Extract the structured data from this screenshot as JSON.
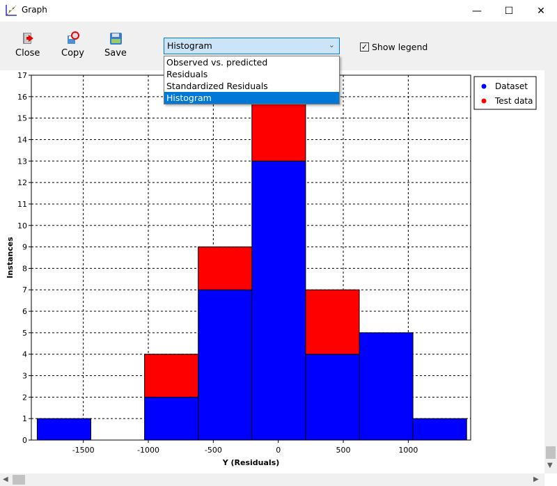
{
  "window": {
    "title": "Graph"
  },
  "toolbar": {
    "close": "Close",
    "copy": "Copy",
    "save": "Save",
    "show_legend": "Show legend",
    "show_legend_checked": true
  },
  "combo": {
    "selected": "Histogram",
    "options": [
      "Observed vs. predicted",
      "Residuals",
      "Standardized Residuals",
      "Histogram"
    ]
  },
  "chart_data": {
    "type": "bar",
    "stacked": true,
    "xlabel": "Y (Residuals)",
    "ylabel": "Instances",
    "xlim": [
      -1900,
      1480
    ],
    "ylim": [
      0,
      17
    ],
    "xticks": [
      -1500,
      -1000,
      -500,
      0,
      500,
      1000
    ],
    "yticks": [
      0,
      1,
      2,
      3,
      4,
      5,
      6,
      7,
      8,
      9,
      10,
      11,
      12,
      13,
      14,
      15,
      16,
      17
    ],
    "grid": true,
    "legend": "top-right (outside)",
    "bin_edges": [
      -1855,
      -1442,
      -1029,
      -616,
      -203,
      210,
      623,
      1036,
      1449
    ],
    "series": [
      {
        "name": "Dataset",
        "color": "#0000ff",
        "values": [
          1,
          0,
          2,
          7,
          13,
          4,
          5,
          1
        ]
      },
      {
        "name": "Test data",
        "color": "#ff0000",
        "values": [
          0,
          0,
          2,
          2,
          3,
          3,
          0,
          0
        ]
      }
    ]
  }
}
